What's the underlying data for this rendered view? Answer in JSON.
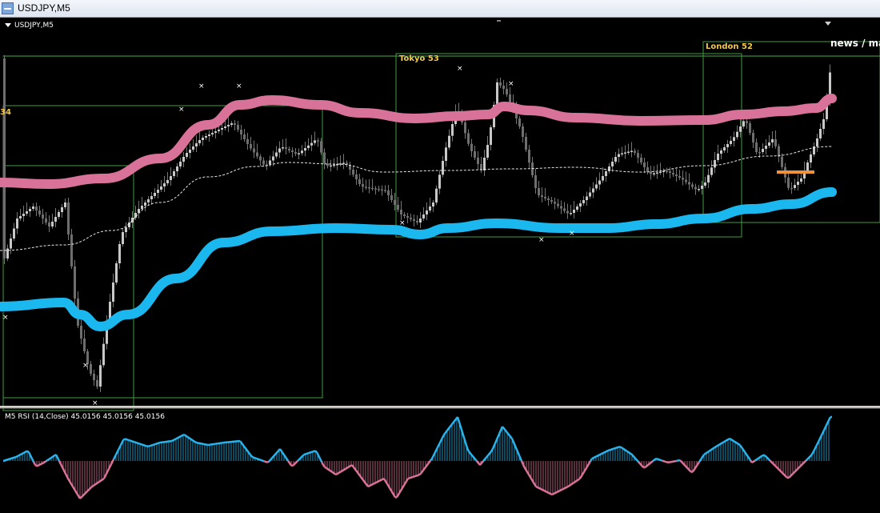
{
  "window": {
    "title": "USDJPY,M5"
  },
  "chart": {
    "symbol_label": "USDJPY,M5"
  },
  "sessions": [
    {
      "name": "Tokyo  53",
      "color": "#f2c94c"
    },
    {
      "name": "London  52",
      "color": "#f2c94c"
    }
  ],
  "left_box_label": "34",
  "news_label": "news / ma",
  "rsi": {
    "label": "M5 RSI (14,Close) 45.0156 45.0156 45.0156"
  },
  "colors": {
    "upper_band": "#d97298",
    "lower_band": "#1ab8ef",
    "rsi_up": "#2ab3ea",
    "rsi_down": "#d97298",
    "box": "#3f9b3f",
    "candle": "#9a9a9a",
    "orange_level": "#f0923a"
  }
}
